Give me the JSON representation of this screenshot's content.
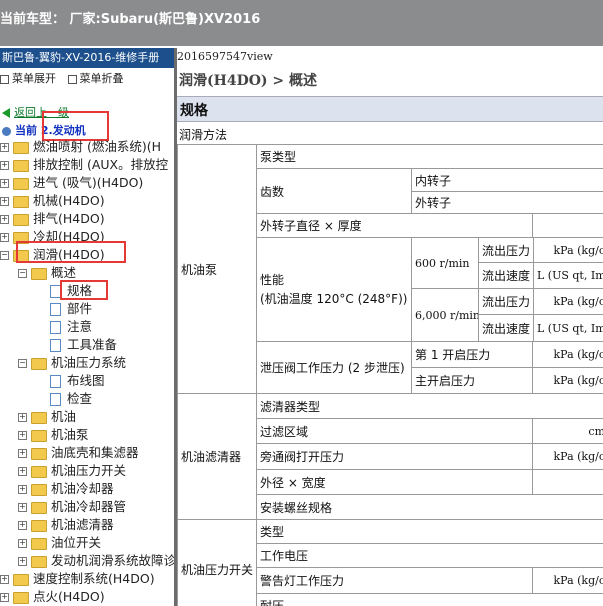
{
  "topbar": {
    "text": "当前车型：  厂家:Subaru(斯巴鲁)XV2016"
  },
  "left": {
    "title": "斯巴鲁-翼豹-XV-2016-维修手册",
    "expand_all": "菜单展开",
    "collapse_all": "菜单折叠",
    "back": "返回上一级",
    "current_prefix": "当前",
    "current_value": "2.发动机",
    "tree": [
      {
        "label": "燃油喷射 (燃油系统)(H"
      },
      {
        "label": "排放控制 (AUX。排放控"
      },
      {
        "label": "进气 (吸气)(H4DO)"
      },
      {
        "label": "机械(H4DO)"
      },
      {
        "label": "排气(H4DO)"
      },
      {
        "label": "冷却(H4DO)"
      },
      {
        "label": "润滑(H4DO)"
      },
      {
        "label": "概述"
      },
      {
        "label": "规格"
      },
      {
        "label": "部件"
      },
      {
        "label": "注意"
      },
      {
        "label": "工具准备"
      },
      {
        "label": "机油压力系统"
      },
      {
        "label": "布线图"
      },
      {
        "label": "检查"
      },
      {
        "label": "机油"
      },
      {
        "label": "机油泵"
      },
      {
        "label": "油底壳和集滤器"
      },
      {
        "label": "机油压力开关"
      },
      {
        "label": "机油冷却器"
      },
      {
        "label": "机油冷却器管"
      },
      {
        "label": "机油滤清器"
      },
      {
        "label": "油位开关"
      },
      {
        "label": "发动机润滑系统故障诊"
      },
      {
        "label": "速度控制系统(H4DO)"
      },
      {
        "label": "点火(H4DO)"
      }
    ]
  },
  "right": {
    "filename": "2016597547view",
    "breadcrumb": "润滑(H4DO) > 概述",
    "section": "规格",
    "lub_method": "润滑方法",
    "table": {
      "pump": "机油泵",
      "pump_type": "泵类型",
      "teeth": "齿数",
      "inner_rotor": "内转子",
      "outer_rotor": "外转子",
      "outer_dim": "外转子直径 × 厚度",
      "perf": "性能",
      "perf_sub": "(机油温度 120°C (248°F))",
      "rpm600": "600 r/min",
      "rpm6000": "6,000 r/min",
      "discharge_pressure": "流出压力",
      "discharge_rate": "流出速度",
      "kpa": "kPa (kg/c",
      "lrate": "L (US qt, Imp",
      "relief": "泄压阀工作压力 (2 步泄压)",
      "first_open": "第 1 开启压力",
      "main_open": "主开启压力",
      "filter": "机油滤清器",
      "filter_type": "滤清器类型",
      "filter_area": "过滤区域",
      "cm": "cm",
      "bypass": "旁通阀打开压力",
      "outer_width": "外径 × 宽度",
      "thread": "安装螺丝规格",
      "switch": "机油压力开关",
      "type": "类型",
      "voltage": "工作电压",
      "warn": "警告灯工作压力",
      "last": "耐压"
    }
  }
}
